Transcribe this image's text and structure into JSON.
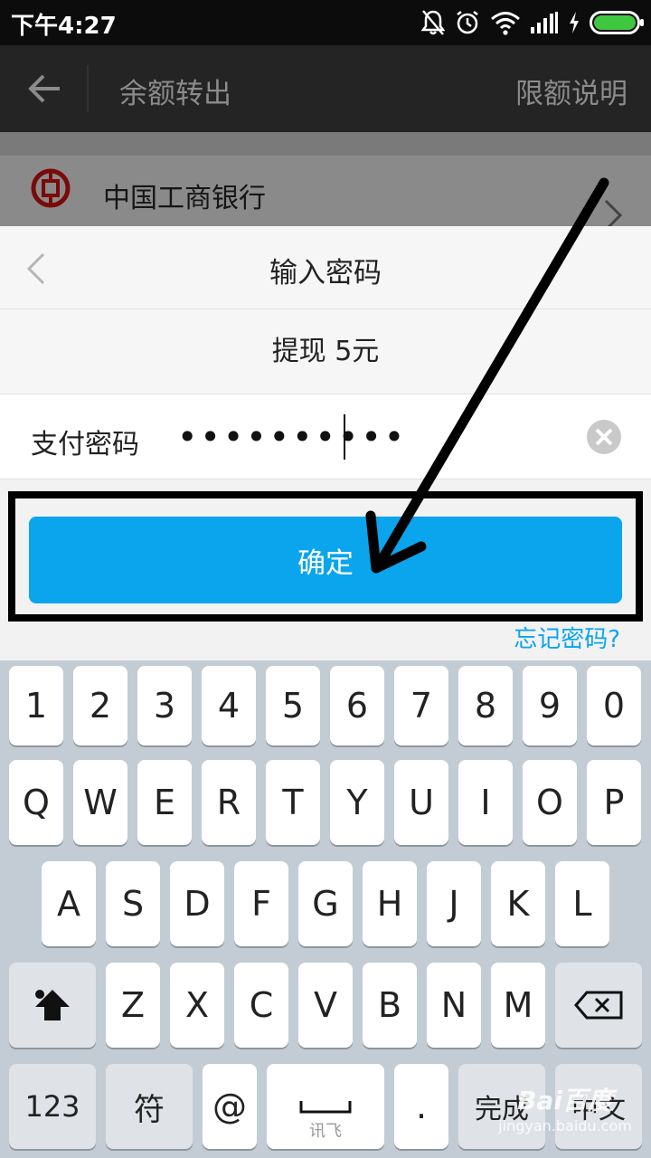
{
  "status_bar": {
    "time": "下午4:27"
  },
  "app_bar": {
    "title": "余额转出",
    "limit_link": "限额说明"
  },
  "background_page": {
    "bank_name": "中国工商银行"
  },
  "sheet": {
    "title": "输入密码",
    "amount_text": "提现 5元",
    "password_label": "支付密码",
    "password_value": "••••••••••",
    "confirm_label": "确定",
    "forgot_label": "忘记密码?"
  },
  "keyboard": {
    "row1": [
      "1",
      "2",
      "3",
      "4",
      "5",
      "6",
      "7",
      "8",
      "9",
      "0"
    ],
    "row2": [
      "Q",
      "W",
      "E",
      "R",
      "T",
      "Y",
      "U",
      "I",
      "O",
      "P"
    ],
    "row3": [
      "A",
      "S",
      "D",
      "F",
      "G",
      "H",
      "J",
      "K",
      "L"
    ],
    "row4": [
      "Z",
      "X",
      "C",
      "V",
      "B",
      "N",
      "M"
    ],
    "bottom": {
      "numeric": "123",
      "symbols": "符",
      "at": "@",
      "space_sub": "讯飞",
      "period": ".",
      "done": "完成",
      "lang": "中文"
    }
  },
  "watermark": {
    "line1": "Bai百度",
    "line2": "jingyan.baidu.com"
  },
  "colors": {
    "accent": "#0aa5ec",
    "battery": "#3fc83f",
    "highlight": "#000000"
  }
}
